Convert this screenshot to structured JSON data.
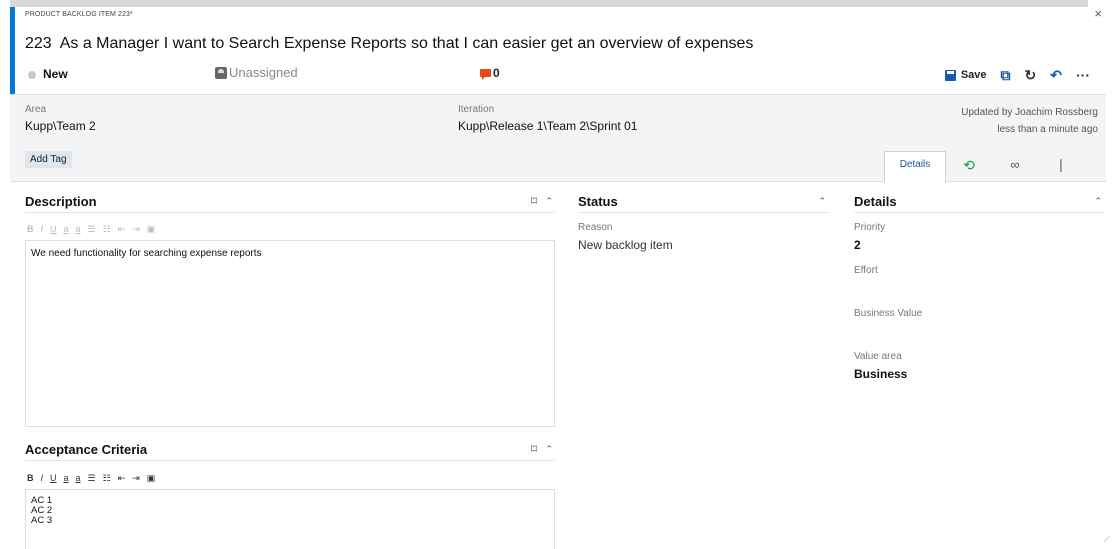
{
  "window": {
    "item_type": "PRODUCT BACKLOG ITEM 223*",
    "close_glyph": "×"
  },
  "work_item": {
    "id": "223",
    "title": "As a Manager I want to Search Expense Reports so that I can easier get an overview of expenses",
    "state": "New",
    "assigned_to": "Unassigned",
    "comment_count": "0"
  },
  "toolbar": {
    "save_label": "Save",
    "copy_icon": "⧉",
    "refresh_icon": "↻",
    "undo_icon": "↶",
    "more_icon": "···"
  },
  "header": {
    "area_label": "Area",
    "area_value": "Kupp\\Team 2",
    "iteration_label": "Iteration",
    "iteration_value": "Kupp\\Release 1\\Team 2\\Sprint 01",
    "updated_by": "Updated by Joachim Rossberg",
    "updated_when": "less than a minute ago",
    "add_tag_label": "Add Tag"
  },
  "tabs": {
    "details": "Details",
    "history_icon": "⟲",
    "links_icon": "∞",
    "attachments_icon": "❘"
  },
  "description": {
    "title": "Description",
    "text": "We need functionality for searching expense reports"
  },
  "acceptance": {
    "title": "Acceptance Criteria",
    "line1": "AC 1",
    "line2": "AC 2",
    "line3": "AC 3"
  },
  "status": {
    "title": "Status",
    "reason_label": "Reason",
    "reason_value": "New backlog item"
  },
  "details": {
    "title": "Details",
    "priority_label": "Priority",
    "priority_value": "2",
    "effort_label": "Effort",
    "effort_value": "",
    "business_value_label": "Business Value",
    "business_value_value": "",
    "value_area_label": "Value area",
    "value_area_value": "Business"
  },
  "format_bar": {
    "bold": "B",
    "italic": "I",
    "underline": "U",
    "highlight": "a",
    "font_color": "a",
    "bullets": "☰",
    "numbered": "☷",
    "outdent": "⇤",
    "indent": "⇥",
    "image": "▣"
  },
  "icons": {
    "maximize": "⌑",
    "collapse": "⌃"
  },
  "colors": {
    "accent": "#0078d7",
    "comment": "#e84a1a",
    "history": "#1c9a3c"
  }
}
